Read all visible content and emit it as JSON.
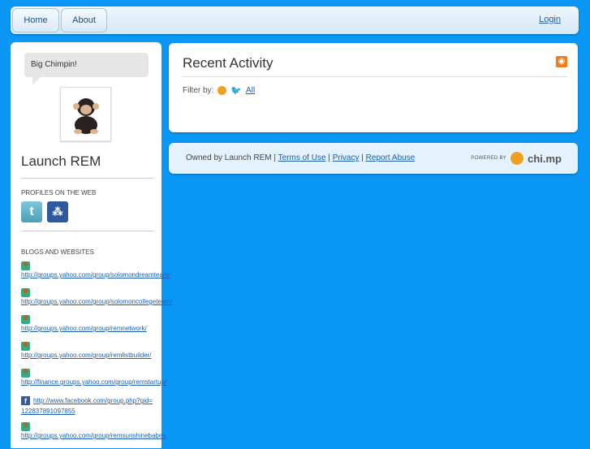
{
  "nav": {
    "home": "Home",
    "about": "About",
    "login": "Login"
  },
  "sidebar": {
    "status": "Big Chimpin!",
    "name": "Launch REM",
    "profiles_title": "PROFILES ON THE WEB",
    "profiles": [
      {
        "icon": "twitter-icon"
      },
      {
        "icon": "myspace-icon"
      }
    ],
    "blogs_title": "BLOGS AND WEBSITES",
    "links": [
      {
        "icon": "yahoo-groups-icon",
        "url": "http://groups.yahoo.com/group/solomondreamteam/"
      },
      {
        "icon": "yahoo-groups-icon",
        "url": "http://groups.yahoo.com/group/solomoncollegeteam/"
      },
      {
        "icon": "yahoo-groups-icon",
        "url": "http://groups.yahoo.com/group/remnetwork/"
      },
      {
        "icon": "yahoo-groups-icon",
        "url": "http://groups.yahoo.com/group/remlistbuilder/"
      },
      {
        "icon": "yahoo-groups-icon",
        "url": "http://finance.groups.yahoo.com/group/remstartup/"
      },
      {
        "icon": "facebook-icon",
        "url": "http://www.facebook.com/group.php?gid=122837891097855"
      },
      {
        "icon": "yahoo-groups-icon",
        "url": "http://groups.yahoo.com/group/remsunshinebabes"
      }
    ]
  },
  "activity": {
    "title": "Recent Activity",
    "filter_label": "Filter by:",
    "filter_all": "All"
  },
  "footer": {
    "owned": "Owned by Launch REM |",
    "terms": "Terms of Use",
    "sep": "|",
    "privacy": "Privacy",
    "sep2": "|",
    "abuse": "Report Abuse",
    "powered": "POWERED BY",
    "brand": "chi.mp"
  }
}
